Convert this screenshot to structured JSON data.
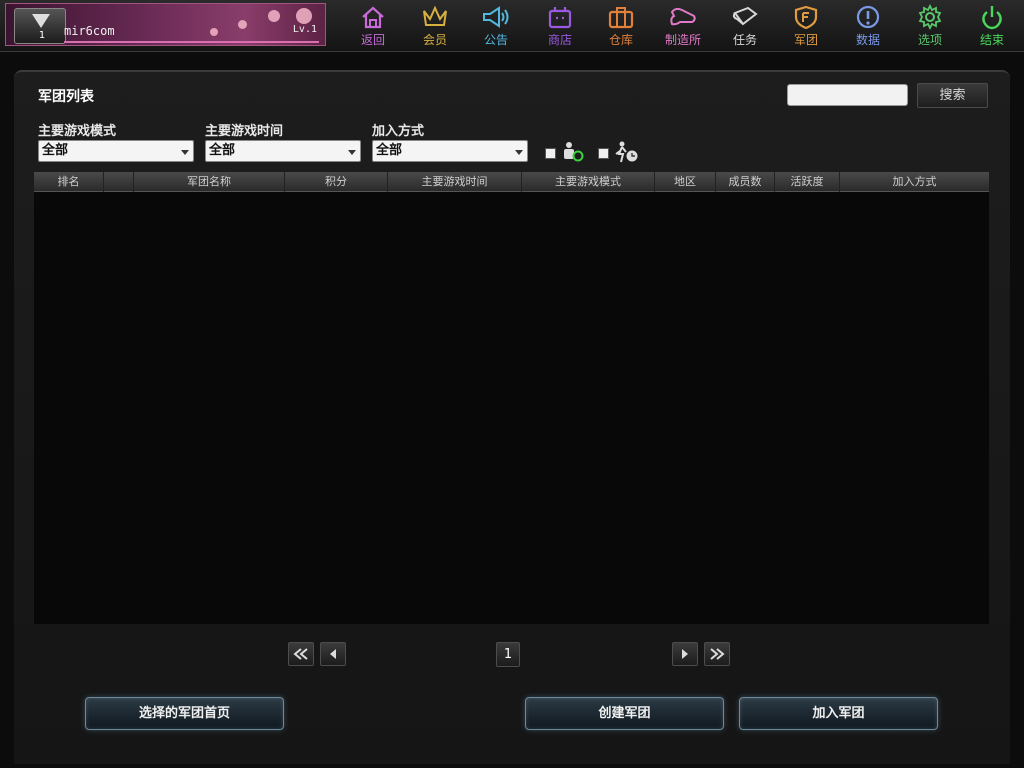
{
  "profile": {
    "avatar_number": "1",
    "player_name": "mir6com",
    "level": "Lv.1"
  },
  "nav": [
    {
      "label": "返回",
      "icon": "home-icon",
      "color": "#c86bd8"
    },
    {
      "label": "会员",
      "icon": "crown-icon",
      "color": "#d8b040"
    },
    {
      "label": "公告",
      "icon": "megaphone-icon",
      "color": "#52b8e0"
    },
    {
      "label": "商店",
      "icon": "shop-icon",
      "color": "#9a5ae0"
    },
    {
      "label": "仓库",
      "icon": "briefcase-icon",
      "color": "#e0803a"
    },
    {
      "label": "制造所",
      "icon": "anvil-icon",
      "color": "#e07ac8"
    },
    {
      "label": "任务",
      "icon": "scroll-icon",
      "color": "#d8d8d8"
    },
    {
      "label": "军团",
      "icon": "shield-icon",
      "color": "#e09a40"
    },
    {
      "label": "数据",
      "icon": "info-icon",
      "color": "#7a9ae8"
    },
    {
      "label": "选项",
      "icon": "gear-icon",
      "color": "#5ac86a"
    },
    {
      "label": "结束",
      "icon": "power-icon",
      "color": "#4ad85a"
    }
  ],
  "panel": {
    "title": "军团列表",
    "search_button": "搜索",
    "search_value": ""
  },
  "filters": [
    {
      "label": "主要游戏模式",
      "value": "全部"
    },
    {
      "label": "主要游戏时间",
      "value": "全部"
    },
    {
      "label": "加入方式",
      "value": "全部"
    }
  ],
  "toggle_icons": [
    "online-member-icon",
    "recent-activity-icon"
  ],
  "table": {
    "columns": [
      "排名",
      "",
      "军团名称",
      "积分",
      "主要游戏时间",
      "主要游戏模式",
      "地区",
      "成员数",
      "活跃度",
      "加入方式"
    ],
    "rows": []
  },
  "pagination": {
    "current_page": "1"
  },
  "buttons": {
    "guild_home": "选择的军团首页",
    "create_guild": "创建军团",
    "join_guild": "加入军团"
  }
}
